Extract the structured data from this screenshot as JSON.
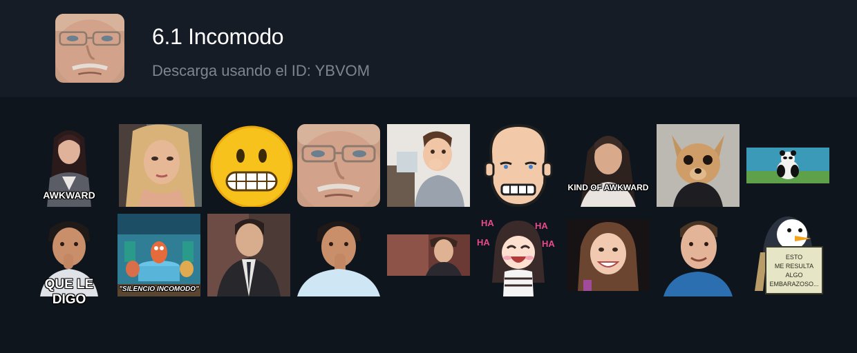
{
  "pack": {
    "title": "6.1 Incomodo",
    "subtitle": "Descarga usando el ID: YBVOM",
    "thumbnail_icon": "old-man-face-sticker"
  },
  "stickers": [
    {
      "icon": "awkward-woman-sticker",
      "caption": "AWKWARD"
    },
    {
      "icon": "blonde-woman-side-eye-sticker"
    },
    {
      "icon": "grimacing-emoji-sticker"
    },
    {
      "icon": "old-man-face-sticker"
    },
    {
      "icon": "toddler-hand-on-mouth-sticker"
    },
    {
      "icon": "cartoon-bald-man-sticker"
    },
    {
      "icon": "kind-of-awkward-woman-sticker",
      "caption": "KIND OF AWKWARD"
    },
    {
      "icon": "chihuahua-dog-sticker"
    },
    {
      "icon": "panda-kung-fu-sticker"
    },
    {
      "icon": "man-biting-finger-sticker",
      "caption": "QUE LE DIGO"
    },
    {
      "icon": "silencio-incomodo-fish-sticker",
      "caption": "\"SILENCIO INCOMODO\""
    },
    {
      "icon": "man-in-suit-sticker"
    },
    {
      "icon": "man-nervous-hand-sticker"
    },
    {
      "icon": "man-looking-at-camera-sticker"
    },
    {
      "icon": "anime-girl-laughing-sticker",
      "ha_labels": [
        "HA",
        "HA",
        "HA",
        "HA"
      ]
    },
    {
      "icon": "woman-awkward-smile-sticker"
    },
    {
      "icon": "man-smiling-sticker"
    },
    {
      "icon": "penguin-sign-sticker",
      "sign_text": [
        "ESTO",
        "ME RESULTA",
        "ALGO",
        "EMBARAZOSO..."
      ]
    }
  ],
  "colors": {
    "page_bg": "#0e151d",
    "header_bg": "#151c25",
    "title": "#ffffff",
    "subtitle": "#7d858f",
    "emoji_yellow": "#f7c21b",
    "ha_pink": "#e94b8a"
  }
}
